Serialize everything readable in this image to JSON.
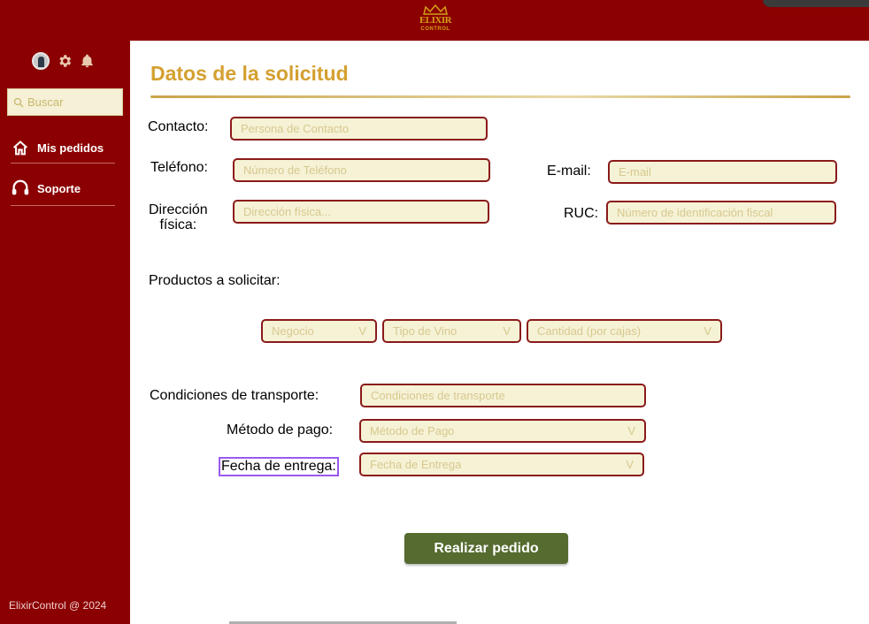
{
  "brand": {
    "name": "ELIXIR",
    "sub": "CONTROL",
    "accent": "#d4a017"
  },
  "sidebar": {
    "search_placeholder": "Buscar",
    "items": [
      {
        "label": "Mis pedidos",
        "icon": "home-icon"
      },
      {
        "label": "Soporte",
        "icon": "headset-icon"
      }
    ],
    "footer": "ElixirControl @ 2024"
  },
  "form": {
    "title": "Datos de la solicitud",
    "contacto": {
      "label": "Contacto:",
      "placeholder": "Persona de Contacto"
    },
    "telefono": {
      "label": "Teléfono:",
      "placeholder": "Número de Teléfono"
    },
    "email": {
      "label": "E-mail:",
      "placeholder": "E-mail"
    },
    "direccion": {
      "label_1": "Dirección",
      "label_2": "física:",
      "placeholder": "Dirección física..."
    },
    "ruc": {
      "label": "RUC:",
      "placeholder": "Número de identificación fiscal"
    },
    "productos": {
      "label": "Productos a solicitar:",
      "negocio": "Negocio",
      "tipo_vino": "Tipo de Vino",
      "cantidad": "Cantidad (por cajas)",
      "chevron": "V"
    },
    "transporte": {
      "label": "Condiciones de transporte:",
      "placeholder": "Condiciones de transporte"
    },
    "pago": {
      "label": "Método de pago:",
      "placeholder": "Método de Pago",
      "chevron": "V"
    },
    "entrega": {
      "label": "Fecha de entrega:",
      "placeholder": "Fecha de Entrega",
      "chevron": "V"
    },
    "submit": "Realizar pedido"
  },
  "colors": {
    "primary": "#8b0000",
    "accent": "#d4a030",
    "field_bg": "#f5f2d6",
    "button": "#556b2f"
  }
}
